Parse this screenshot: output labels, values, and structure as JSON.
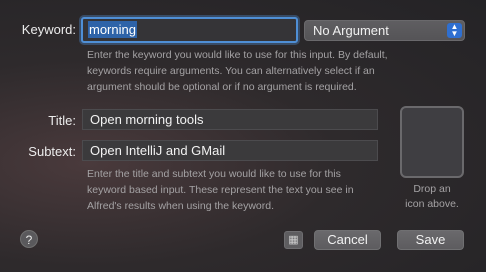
{
  "keyword": {
    "label": "Keyword:",
    "value": "morning",
    "argument_option": "No Argument",
    "help": [
      "Enter the keyword you would like to use for this input. By default,",
      "keywords require arguments. You can alternatively select if an",
      "argument should be optional or if no argument is required."
    ]
  },
  "title": {
    "label": "Title:",
    "value": "Open morning tools"
  },
  "subtext": {
    "label": "Subtext:",
    "value": "Open IntelliJ and GMail",
    "help": [
      "Enter the title and subtext you would like to use for this",
      "keyword based input. These represent the text you see in",
      "Alfred's results when using the keyword."
    ]
  },
  "icon_well": {
    "hint_line1": "Drop an",
    "hint_line2": "icon above."
  },
  "footer": {
    "help_glyph": "?",
    "grid_glyph": "▦",
    "cancel_label": "Cancel",
    "save_label": "Save"
  },
  "colors": {
    "accent": "#2f6fd0",
    "selection": "#2e63a8",
    "focus_ring": "#4f8fd6"
  },
  "icons": {
    "help": "help-icon",
    "grid": "grid-icon",
    "dropdown": "chevron-updown-icon"
  }
}
